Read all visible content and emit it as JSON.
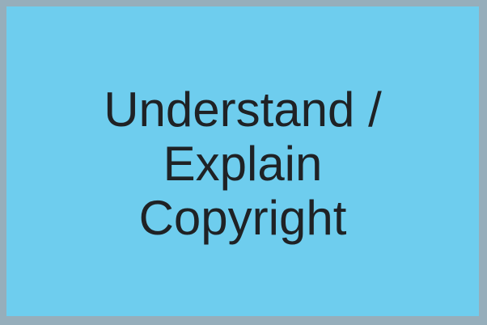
{
  "box": {
    "lines": [
      "Understand /",
      "Explain",
      "Copyright"
    ],
    "fill_color": "#6ecdee",
    "border_color": "#96aebb",
    "text_color": "#1f2225"
  }
}
